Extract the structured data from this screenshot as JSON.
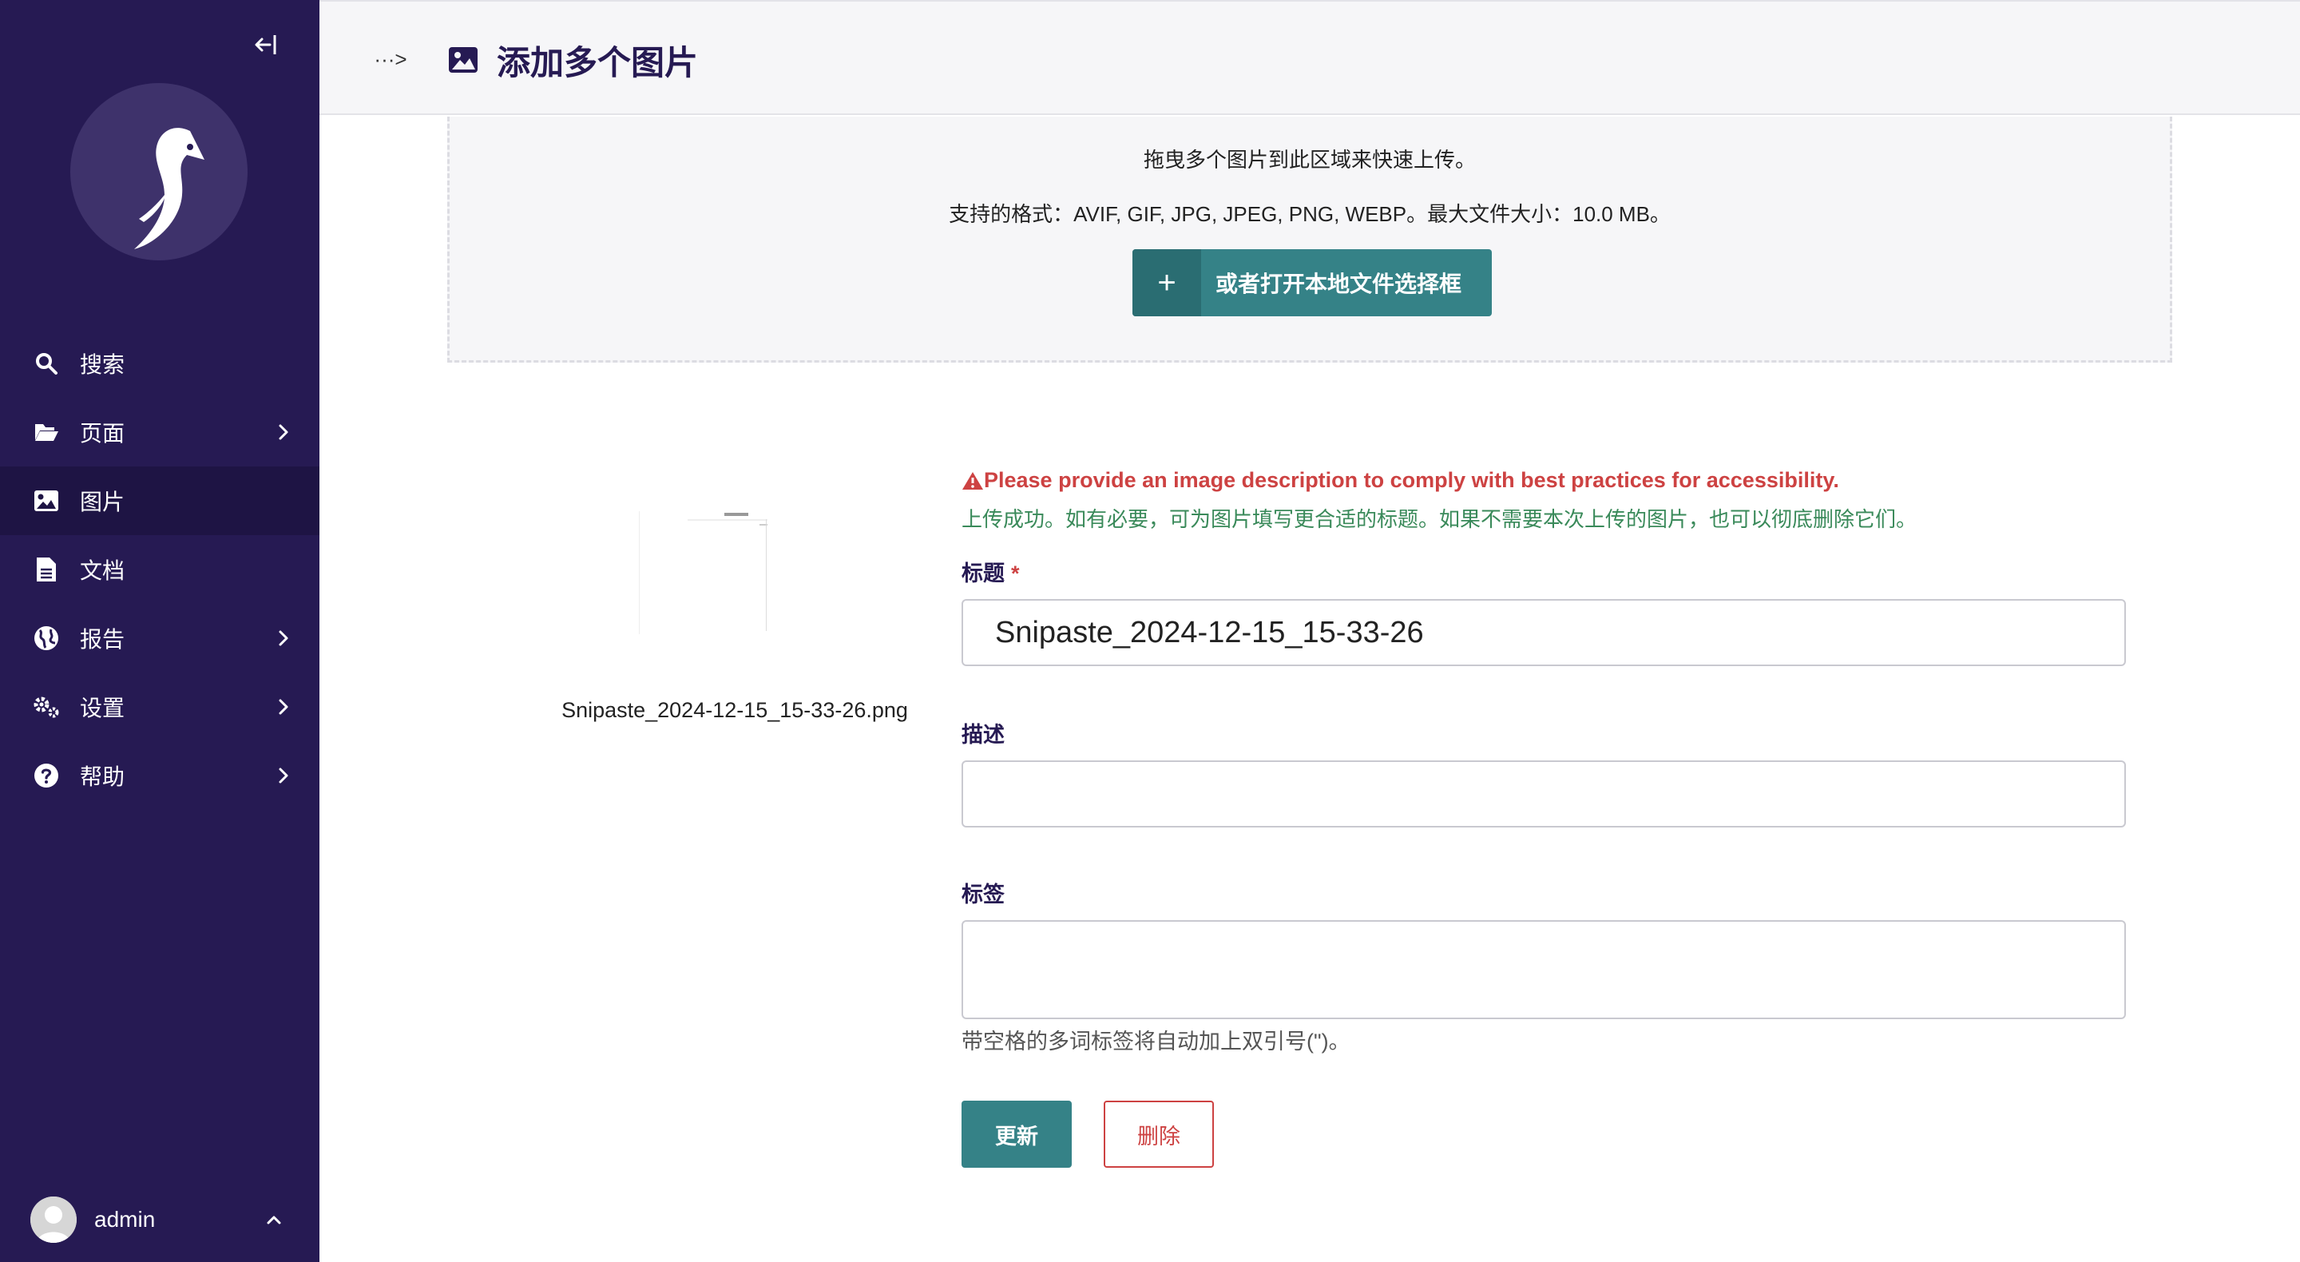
{
  "sidebar": {
    "items": [
      {
        "label": "搜索",
        "icon": "search-icon"
      },
      {
        "label": "页面",
        "icon": "folder-open-icon"
      },
      {
        "label": "图片",
        "icon": "image-icon"
      },
      {
        "label": "文档",
        "icon": "document-icon"
      },
      {
        "label": "报告",
        "icon": "globe-icon"
      },
      {
        "label": "设置",
        "icon": "cogs-icon"
      },
      {
        "label": "帮助",
        "icon": "help-icon"
      }
    ],
    "active_item": "图片",
    "user": {
      "name": "admin"
    }
  },
  "header": {
    "breadcrumb_toggle": "···>",
    "title": "添加多个图片"
  },
  "dropzone": {
    "instruction": "拖曳多个图片到此区域来快速上传。",
    "formats": "支持的格式：AVIF, GIF, JPG, JPEG, PNG, WEBP。最大文件大小：10.0 MB。",
    "button_label": "或者打开本地文件选择框",
    "button_icon": "+"
  },
  "upload": {
    "filename": "Snipaste_2024-12-15_15-33-26.png",
    "warning": "Please provide an image description to comply with best practices for accessibility.",
    "success": "上传成功。如有必要，可为图片填写更合适的标题。如果不需要本次上传的图片，也可以彻底删除它们。",
    "fields": {
      "title_label": "标题",
      "required_mark": "*",
      "title_value": "Snipaste_2024-12-15_15-33-26",
      "description_label": "描述",
      "description_value": "",
      "tags_label": "标签",
      "tags_value": "",
      "tags_help": "带空格的多词标签将自动加上双引号(\")。"
    },
    "update_button": "更新",
    "delete_button": "删除"
  },
  "colors": {
    "sidebar_bg": "#261a53",
    "accent": "#358287",
    "danger": "#cd4242",
    "success": "#3a8a5a"
  }
}
